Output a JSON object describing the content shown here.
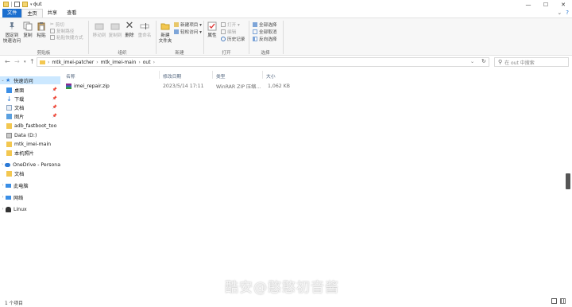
{
  "window": {
    "title": "out",
    "controls": [
      "—",
      "☐",
      "✕"
    ]
  },
  "tabs": [
    {
      "label": "文件"
    },
    {
      "label": "主页"
    },
    {
      "label": "共享"
    },
    {
      "label": "查看"
    }
  ],
  "ribbon": {
    "clipboard": {
      "pin_label": "固定到\n快速访问",
      "copy_label": "复制",
      "paste_label": "粘贴",
      "cut_label": "剪切",
      "copy_path_label": "复制路径",
      "paste_shortcut_label": "粘贴快捷方式",
      "group_label": "剪贴板"
    },
    "organize": {
      "move_to_label": "移动到",
      "copy_to_label": "复制到",
      "delete_label": "删除",
      "rename_label": "重命名",
      "group_label": "组织"
    },
    "new": {
      "new_folder_label": "新建\n文件夹",
      "new_item_label": "新建项目 ▾",
      "easy_access_label": "轻松访问 ▾",
      "group_label": "新建"
    },
    "open": {
      "properties_label": "属性",
      "open_label": "打开 ▾",
      "edit_label": "编辑",
      "history_label": "历史记录",
      "group_label": "打开"
    },
    "select": {
      "select_all_label": "全部选择",
      "select_none_label": "全部取消",
      "invert_label": "反向选择",
      "group_label": "选择"
    }
  },
  "address": {
    "crumbs": [
      "mtk_imei-patcher",
      "mtk_imei-main",
      "out"
    ],
    "search_placeholder": "在 out 中搜索"
  },
  "navpane": {
    "items": [
      {
        "label": "快速访问",
        "icon": "star-icon",
        "selected": true
      },
      {
        "label": "桌面",
        "icon": "desktop-icon",
        "pinned": true
      },
      {
        "label": "下载",
        "icon": "download-icon",
        "pinned": true
      },
      {
        "label": "文档",
        "icon": "document-icon",
        "pinned": true
      },
      {
        "label": "图片",
        "icon": "picture-icon",
        "pinned": true
      },
      {
        "label": "adb_fastboot_too",
        "icon": "folder-icon"
      },
      {
        "label": "Data (D:)",
        "icon": "drive-icon"
      },
      {
        "label": "mtk_imei-main",
        "icon": "folder-icon"
      },
      {
        "label": "本机照片",
        "icon": "folder-icon"
      },
      {
        "label": "OneDrive - Persona",
        "icon": "cloud-icon"
      },
      {
        "label": "文档",
        "icon": "folder-icon"
      },
      {
        "label": "此电脑",
        "icon": "computer-icon"
      },
      {
        "label": "网络",
        "icon": "network-icon"
      },
      {
        "label": "Linux",
        "icon": "linux-icon"
      }
    ]
  },
  "files": {
    "columns": [
      "名称",
      "修改日期",
      "类型",
      "大小"
    ],
    "rows": [
      {
        "name": "imei_repair.zip",
        "modified": "2023/5/14 17:11",
        "type": "WinRAR ZIP 压缩...",
        "size": "1,062 KB",
        "icon": "winrar-archive-icon"
      }
    ]
  },
  "status": {
    "count": "1 个项目"
  },
  "watermark": "酷安@憨憨初音酱",
  "colors": {
    "accent": "#1c6fcf",
    "selection": "#cce8ff",
    "folder": "#f3c750"
  }
}
